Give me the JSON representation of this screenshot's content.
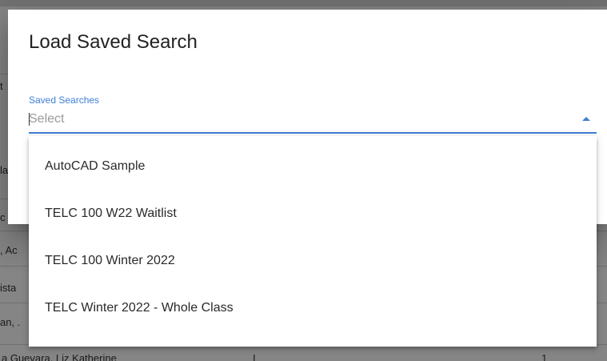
{
  "modal": {
    "title": "Load Saved Search",
    "field_label": "Saved Searches",
    "field_placeholder": "Select"
  },
  "dropdown": {
    "options": [
      "AutoCAD Sample",
      "TELC 100 W22 Waitlist",
      "TELC 100 Winter 2022",
      "TELC Winter 2022 - Whole Class"
    ]
  },
  "background": {
    "fragments": [
      "t",
      "la",
      "c",
      ", Ac",
      "ista",
      "an, ."
    ],
    "last_row": {
      "name": "a Guevara, Liz Katherine",
      "col_a": "I",
      "col_b": "1"
    }
  },
  "colors": {
    "accent": "#3f7fd6",
    "overlay": "rgba(0,0,0,0.48)"
  }
}
